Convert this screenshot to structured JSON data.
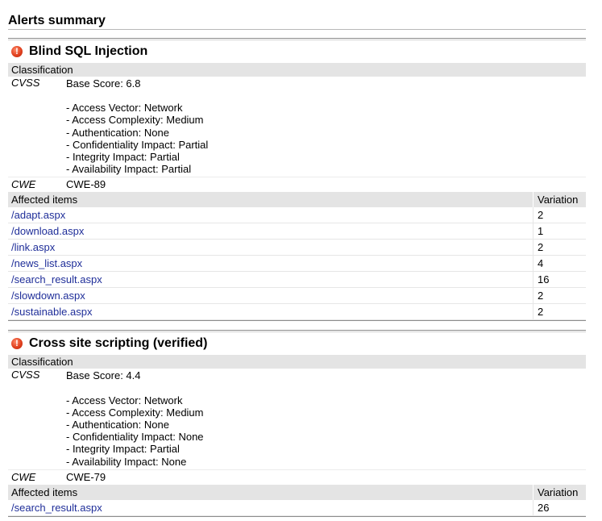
{
  "summary": {
    "title": "Alerts summary"
  },
  "labels": {
    "classification": "Classification",
    "cvss": "CVSS",
    "cwe": "CWE",
    "affected_items": "Affected items",
    "variation": "Variation"
  },
  "icon": {
    "name": "alert-error-icon",
    "glyph": "!",
    "color": "#e0401e"
  },
  "colors": {
    "link": "#1f2e99",
    "section_bg": "#e4e4e4"
  },
  "alerts": [
    {
      "title": "Blind SQL Injection",
      "base_score": "Base Score: 6.8",
      "metrics": [
        "- Access Vector: Network",
        "- Access Complexity: Medium",
        "- Authentication: None",
        "- Confidentiality Impact: Partial",
        "- Integrity Impact: Partial",
        "- Availability Impact: Partial"
      ],
      "cwe": "CWE-89",
      "items": [
        {
          "path": "/adapt.aspx",
          "variation": "2"
        },
        {
          "path": "/download.aspx",
          "variation": "1"
        },
        {
          "path": "/link.aspx",
          "variation": "2"
        },
        {
          "path": "/news_list.aspx",
          "variation": "4"
        },
        {
          "path": "/search_result.aspx",
          "variation": "16"
        },
        {
          "path": "/slowdown.aspx",
          "variation": "2"
        },
        {
          "path": "/sustainable.aspx",
          "variation": "2"
        }
      ]
    },
    {
      "title": "Cross site scripting (verified)",
      "base_score": "Base Score: 4.4",
      "metrics": [
        "- Access Vector: Network",
        "- Access Complexity: Medium",
        "- Authentication: None",
        "- Confidentiality Impact: None",
        "- Integrity Impact: Partial",
        "- Availability Impact: None"
      ],
      "cwe": "CWE-79",
      "items": [
        {
          "path": "/search_result.aspx",
          "variation": "26"
        }
      ]
    }
  ]
}
